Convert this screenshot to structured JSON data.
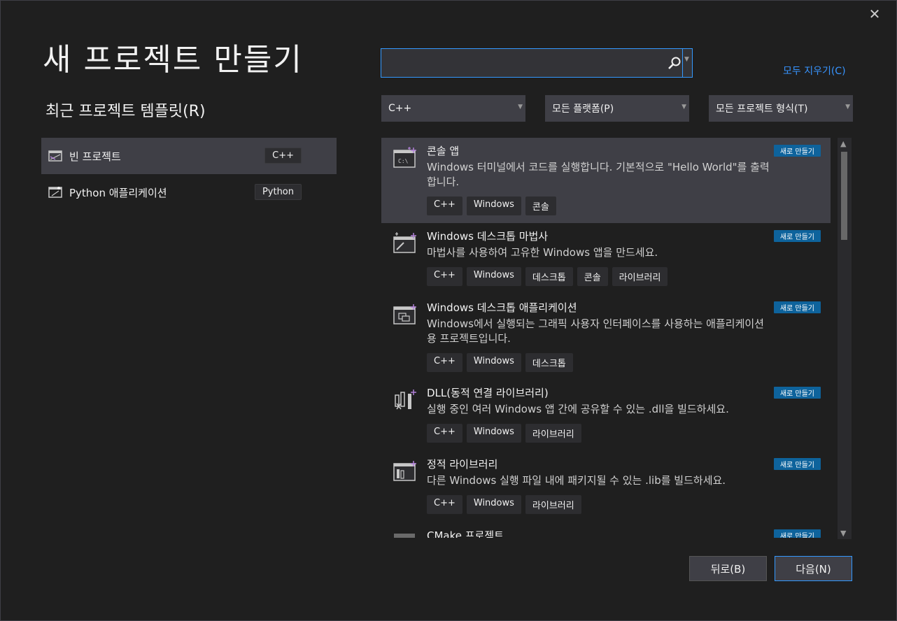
{
  "window": {
    "close_label": "✕"
  },
  "title": "새 프로젝트 만들기",
  "recent": {
    "heading": "최근 프로젝트 템플릿(R)",
    "items": [
      {
        "label": "빈 프로젝트",
        "badge": "C++"
      },
      {
        "label": "Python 애플리케이션",
        "badge": "Python"
      }
    ]
  },
  "search": {
    "value": "",
    "placeholder": ""
  },
  "clear_all": "모두 지우기(C)",
  "filters": {
    "language": "C++",
    "platform": "모든 플랫폼(P)",
    "project_type": "모든 프로젝트 형식(T)"
  },
  "templates": [
    {
      "name": "콘솔 앱",
      "desc": "Windows 터미널에서 코드를 실행합니다. 기본적으로 \"Hello World\"를 출력합니다.",
      "tags": [
        "C++",
        "Windows",
        "콘솔"
      ],
      "badge": "새로 만들기"
    },
    {
      "name": "Windows 데스크톱 마법사",
      "desc": "마법사를 사용하여 고유한 Windows 앱을 만드세요.",
      "tags": [
        "C++",
        "Windows",
        "데스크톱",
        "콘솔",
        "라이브러리"
      ],
      "badge": "새로 만들기"
    },
    {
      "name": "Windows 데스크톱 애플리케이션",
      "desc": "Windows에서 실행되는 그래픽 사용자 인터페이스를 사용하는 애플리케이션용 프로젝트입니다.",
      "tags": [
        "C++",
        "Windows",
        "데스크톱"
      ],
      "badge": "새로 만들기"
    },
    {
      "name": "DLL(동적 연결 라이브러리)",
      "desc": "실행 중인 여러 Windows 앱 간에 공유할 수 있는 .dll을 빌드하세요.",
      "tags": [
        "C++",
        "Windows",
        "라이브러리"
      ],
      "badge": "새로 만들기"
    },
    {
      "name": "정적 라이브러리",
      "desc": "다른 Windows 실행 파일 내에 패키지될 수 있는 .lib를 빌드하세요.",
      "tags": [
        "C++",
        "Windows",
        "라이브러리"
      ],
      "badge": "새로 만들기"
    },
    {
      "name": "CMake 프로젝트",
      "desc": "",
      "tags": [],
      "badge": "새로 만들기"
    }
  ],
  "buttons": {
    "back": "뒤로(B)",
    "next": "다음(N)"
  },
  "colors": {
    "accent": "#3399ff",
    "badge": "#0e639c",
    "background": "#1f1f1f",
    "selected": "#3f3f46"
  },
  "icons": {
    "search": "search-icon",
    "close": "close-icon",
    "template": "project-template-icon"
  }
}
